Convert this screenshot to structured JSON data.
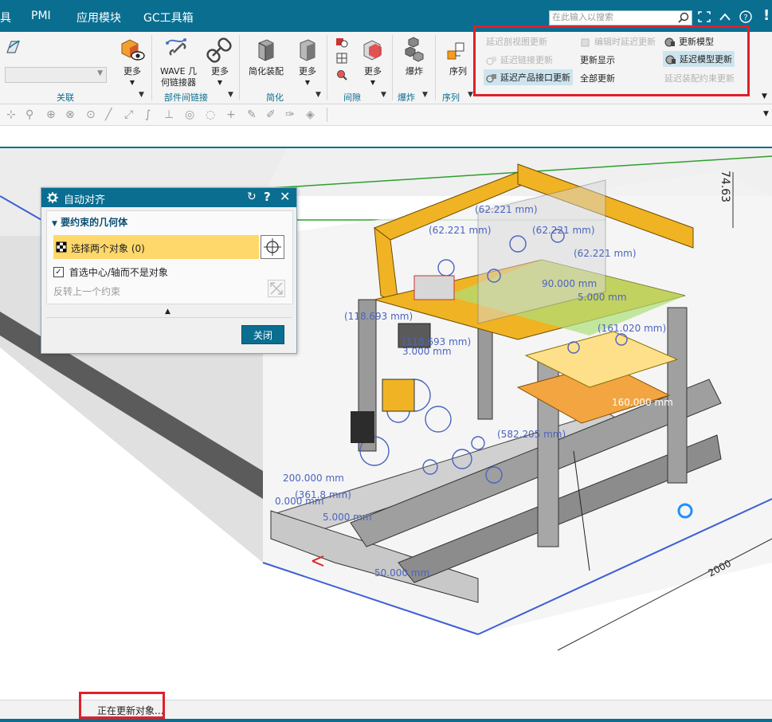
{
  "menu": {
    "tab_partial": "具",
    "tab_pmi": "PMI",
    "tab_apps": "应用模块",
    "tab_gc": "GC工具箱"
  },
  "search": {
    "placeholder": "在此输入以搜索"
  },
  "ribbon": {
    "groups": {
      "relate": "关联",
      "interpart": "部件间链接",
      "simplify": "简化",
      "clearance": "间隙",
      "explode": "爆炸",
      "sequence": "序列"
    },
    "buttons": {
      "more1": "更多",
      "wave_line1": "WAVE 几",
      "wave_line2": "何链接器",
      "more2": "更多",
      "simplify_assembly": "简化装配",
      "more3": "更多",
      "more4": "更多",
      "explode": "爆炸",
      "sequence": "序列"
    },
    "update_items": {
      "delay_section_view": "延迟剖视图更新",
      "delay_link": "延迟链接更新",
      "delay_product_interface": "延迟产品接口更新",
      "edit_delay_update": "编辑时延迟更新",
      "update_display": "更新显示",
      "update_all": "全部更新",
      "update_model": "更新模型",
      "delay_model_update": "延迟模型更新",
      "delay_assembly_constraint": "延迟装配约束更新"
    }
  },
  "dialog": {
    "title": "自动对齐",
    "section_title": "要约束的几何体",
    "select_label": "选择两个对象 (0)",
    "checkbox_label": "首选中心/轴而不是对象",
    "checkbox_checked": true,
    "reverse_label": "反转上一个约束",
    "close_button": "关闭"
  },
  "viewport": {
    "dimensions": [
      "74.63",
      "(62.221 mm)",
      "(62.221 mm)",
      "(62.221 mm)",
      "(62.221 mm)",
      "(118.693 mm)",
      "(118.693 mm)",
      "90.000 mm",
      "5.000 mm",
      "(161.020 mm)",
      "3.000 mm",
      "(582.205 mm)",
      "200.000 mm",
      "(361.8 mm)",
      "0.000 mm",
      "5.000 mm",
      "50.000 mm",
      "160.000 mm",
      "2000"
    ]
  },
  "status": {
    "text": "正在更新对象..."
  },
  "colors": {
    "brand": "#0a6e91",
    "highlight_yellow": "#ffd86b",
    "annotation_red": "#e0202a",
    "dimension_blue": "#4b64bf",
    "frame_orange": "#f0b323"
  }
}
